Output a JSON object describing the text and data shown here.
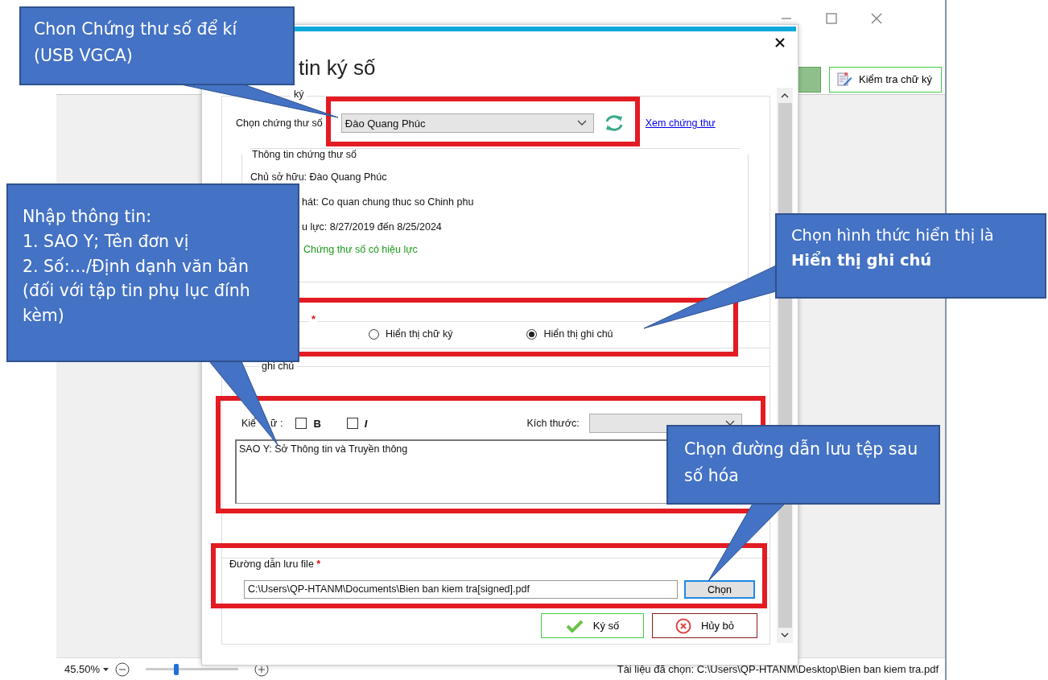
{
  "app": {
    "check_signature_button": "Kiểm tra chữ ký",
    "zoom": {
      "value": "45.50%",
      "level": 0.3
    },
    "status_bar": "Tài liệu đã chọn: C:\\Users\\QP-HTANM\\Desktop\\Bien ban kiem tra.pdf"
  },
  "dialog": {
    "title": "tin ký số",
    "signer": {
      "group_label": "ký",
      "cert_label": "Chọn chứng thư số",
      "cert_value": "Đào Quang Phúc",
      "view_link": "Xem chứng thư"
    },
    "cert_info": {
      "title": "Thông tin chứng thư số",
      "lines": [
        {
          "text": "Chủ sở hữu: Đào Quang Phúc",
          "kind": "plain"
        },
        {
          "text": "hát: Co quan chung thuc so Chinh phu",
          "kind": "cut"
        },
        {
          "text": "u lực: 8/27/2019 đến 8/25/2024",
          "kind": "cut"
        },
        {
          "text": "Chứng thư số có hiệu lực",
          "kind": "valid"
        }
      ]
    },
    "display_mode": {
      "required_mark": "*",
      "options": [
        {
          "label": "Hiển thị chữ ký",
          "selected": false
        },
        {
          "label": "Hiển thị ghi chú",
          "selected": true
        }
      ]
    },
    "note": {
      "group_label": "ghi chú",
      "font_style_label": [
        "Kiể",
        "ữ :"
      ],
      "styles": [
        {
          "label": "B",
          "kind": "bold",
          "checked": false
        },
        {
          "label": "I",
          "kind": "italic",
          "checked": false
        }
      ],
      "size_label": "Kích thước:",
      "text": "SAO Y: Sở Thông tin và Truyền thông"
    },
    "save_path": {
      "label": "Đường dẫn lưu file",
      "required_mark": "*",
      "value": "C:\\Users\\QP-HTANM\\Documents\\Bien ban kiem tra[signed].pdf",
      "browse_button": "Chọn"
    },
    "buttons": [
      {
        "label": "Ký số",
        "kind": "ok"
      },
      {
        "label": "Hủy bỏ",
        "kind": "cancel"
      }
    ]
  },
  "callouts": [
    {
      "text": "Chon Chứng thư số để kí (USB VGCA)",
      "kind": "certificate"
    },
    {
      "text": "Nhập thông tin:\n1. SAO Y; Tên đơn vị\n2. Số:…/Định dạnh văn bản\n(đối với tập tin phụ lục đính kèm)",
      "kind": "note"
    },
    {
      "text": "Chọn hình thức hiển thị là **Hiển thị ghi chú**",
      "kind": "display"
    },
    {
      "text": "Chọn đường dẫn lưu tệp sau số hóa",
      "kind": "path"
    }
  ]
}
